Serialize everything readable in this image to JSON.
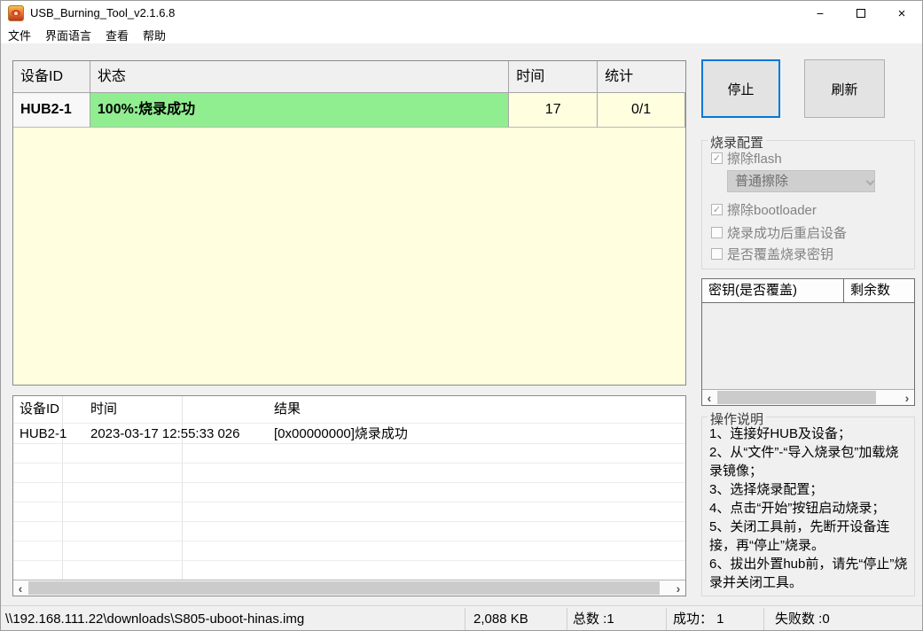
{
  "window": {
    "title": "USB_Burning_Tool_v2.1.6.8",
    "controls": {
      "minimize": "−",
      "close": "×"
    }
  },
  "menu": {
    "items": [
      {
        "label": "文件"
      },
      {
        "label": "界面语言"
      },
      {
        "label": "查看"
      },
      {
        "label": "帮助"
      }
    ]
  },
  "device_table": {
    "columns": [
      "设备ID",
      "状态",
      "时间",
      "统计"
    ],
    "row": {
      "device_id": "HUB2-1",
      "status": "100%:烧录成功",
      "time": "17",
      "stats": "0/1"
    }
  },
  "actions": {
    "stop_label": "停止",
    "refresh_label": "刷新"
  },
  "burn_config": {
    "title": "烧录配置",
    "options": [
      {
        "label": "擦除flash",
        "checked": true,
        "enabled": false
      },
      {
        "label": "擦除bootloader",
        "checked": true,
        "enabled": false
      },
      {
        "label": "烧录成功后重启设备",
        "checked": false,
        "enabled": false
      },
      {
        "label": "是否覆盖烧录密钥",
        "checked": false,
        "enabled": false
      }
    ],
    "erase_mode": {
      "value": "普通擦除",
      "enabled": false
    }
  },
  "key_table": {
    "columns": [
      "密钥(是否覆盖)",
      "剩余数"
    ],
    "rows": []
  },
  "instructions": {
    "title": "操作说明",
    "lines": [
      "1、连接好HUB及设备；",
      "2、从“文件”-“导入烧录包”加载烧录镜像；",
      "3、选择烧录配置；",
      "4、点击“开始”按钮启动烧录；",
      "5、关闭工具前，先断开设备连接，再“停止”烧录。",
      "6、拔出外置hub前，请先“停止”烧录并关闭工具。"
    ]
  },
  "log_table": {
    "columns": [
      "设备ID",
      "时间",
      "结果"
    ],
    "rows": [
      {
        "device_id": "HUB2-1",
        "time": "2023-03-17 12:55:33 026",
        "result": "[0x00000000]烧录成功"
      }
    ]
  },
  "statusbar": {
    "image_path": "\\\\192.168.111.22\\downloads\\S805-uboot-hinas.img",
    "image_size": "2,088 KB",
    "total": "总数 :1",
    "success": "成功： 1",
    "failed": "失败数 :0"
  },
  "icons": {
    "scroll_left": "‹",
    "scroll_right": "›"
  },
  "colors": {
    "accent_blue": "#0078d7",
    "success_green": "#90ee90",
    "pending_yellow": "#ffffe0",
    "panel_gray": "#f0f0f0"
  }
}
